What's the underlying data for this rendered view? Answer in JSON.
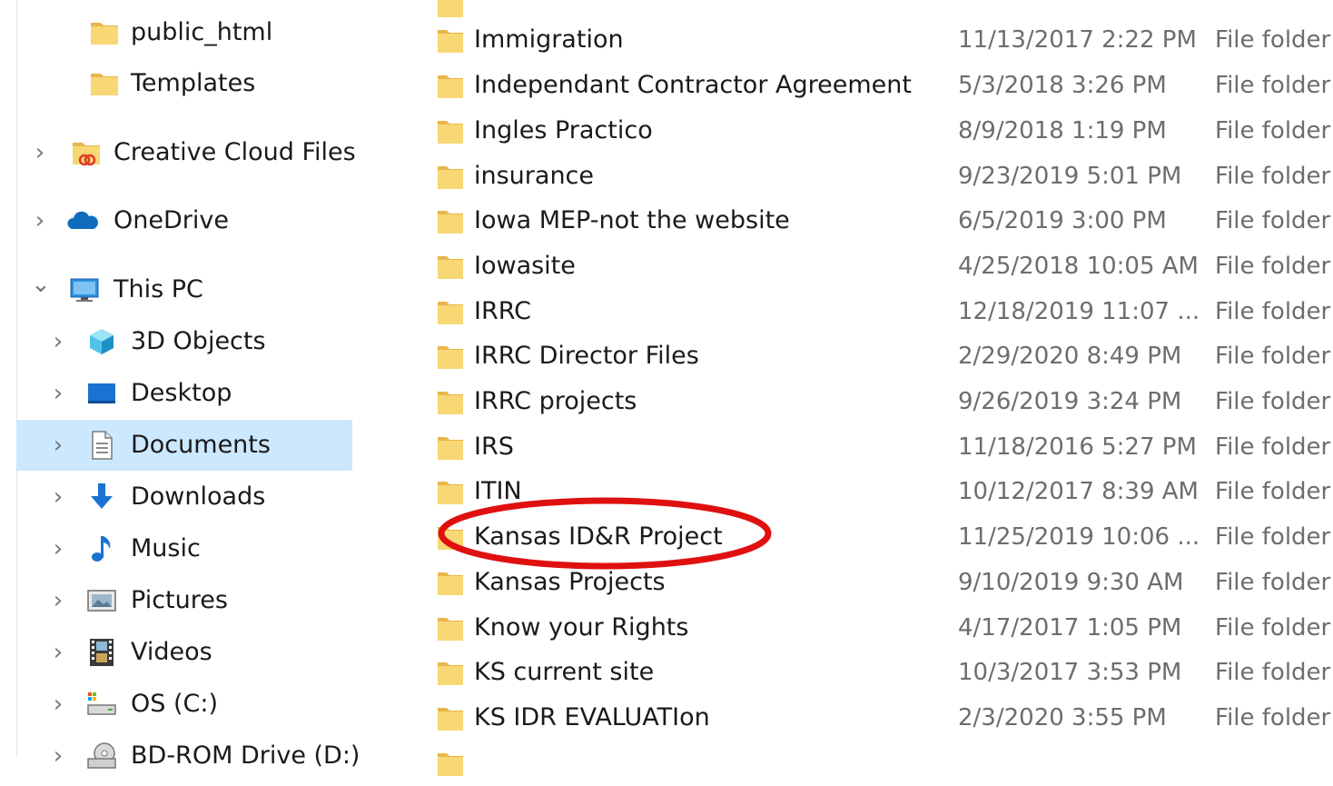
{
  "nav": {
    "items": [
      {
        "label": "public_html",
        "icon": "folder-icon",
        "expander": ""
      },
      {
        "label": "Templates",
        "icon": "folder-icon",
        "expander": ""
      },
      {
        "label": "Creative Cloud Files",
        "icon": "creative-cloud-folder-icon",
        "expander": "›"
      },
      {
        "label": "OneDrive",
        "icon": "cloud-icon",
        "expander": "›"
      },
      {
        "label": "This PC",
        "icon": "monitor-icon",
        "expander": "⌄"
      },
      {
        "label": "3D Objects",
        "icon": "cube-icon",
        "expander": "›"
      },
      {
        "label": "Desktop",
        "icon": "desktop-icon",
        "expander": "›"
      },
      {
        "label": "Documents",
        "icon": "document-icon",
        "expander": "›"
      },
      {
        "label": "Downloads",
        "icon": "download-arrow-icon",
        "expander": "›"
      },
      {
        "label": "Music",
        "icon": "music-note-icon",
        "expander": "›"
      },
      {
        "label": "Pictures",
        "icon": "pictures-icon",
        "expander": "›"
      },
      {
        "label": "Videos",
        "icon": "film-icon",
        "expander": "›"
      },
      {
        "label": "OS (C:)",
        "icon": "drive-icon",
        "expander": "›"
      },
      {
        "label": "BD-ROM Drive (D:)",
        "icon": "disc-drive-icon",
        "expander": "›"
      }
    ],
    "selected": "Documents"
  },
  "files": {
    "rows": [
      {
        "name": "Immigration",
        "date": "11/13/2017 2:22 PM",
        "type": "File folder"
      },
      {
        "name": "Independant Contractor Agreement",
        "date": "5/3/2018 3:26 PM",
        "type": "File folder"
      },
      {
        "name": "Ingles Practico",
        "date": "8/9/2018 1:19 PM",
        "type": "File folder"
      },
      {
        "name": "insurance",
        "date": "9/23/2019 5:01 PM",
        "type": "File folder"
      },
      {
        "name": "Iowa MEP-not the website",
        "date": "6/5/2019 3:00 PM",
        "type": "File folder"
      },
      {
        "name": "Iowasite",
        "date": "4/25/2018 10:05 AM",
        "type": "File folder"
      },
      {
        "name": "IRRC",
        "date": "12/18/2019 11:07 ...",
        "type": "File folder"
      },
      {
        "name": "IRRC Director Files",
        "date": "2/29/2020 8:49 PM",
        "type": "File folder"
      },
      {
        "name": "IRRC projects",
        "date": "9/26/2019 3:24 PM",
        "type": "File folder"
      },
      {
        "name": "IRS",
        "date": "11/18/2016 5:27 PM",
        "type": "File folder"
      },
      {
        "name": "ITIN",
        "date": "10/12/2017 8:39 AM",
        "type": "File folder"
      },
      {
        "name": "Kansas ID&R Project",
        "date": "11/25/2019 10:06 ...",
        "type": "File folder"
      },
      {
        "name": "Kansas Projects",
        "date": "9/10/2019 9:30 AM",
        "type": "File folder"
      },
      {
        "name": "Know your Rights",
        "date": "4/17/2017 1:05 PM",
        "type": "File folder"
      },
      {
        "name": "KS current site",
        "date": "10/3/2017 3:53 PM",
        "type": "File folder"
      },
      {
        "name": "KS IDR EVALUATIon",
        "date": "2/3/2020 3:55 PM",
        "type": "File folder"
      }
    ],
    "highlighted": "Kansas ID&R Project"
  },
  "colors": {
    "folder": "#f8d775",
    "folder_dark": "#e8b64a",
    "selection": "#cce8ff",
    "annotation": "#e01010",
    "secondary_text": "#6d6d6d"
  }
}
